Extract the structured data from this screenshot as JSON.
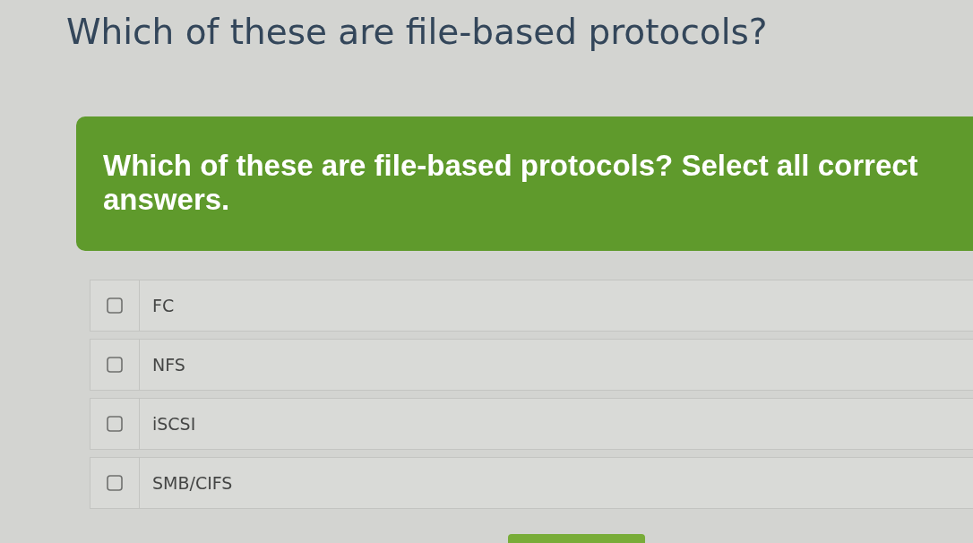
{
  "page": {
    "title": "Which of these are file-based protocols?"
  },
  "question": {
    "prompt": "Which of these are file-based protocols? Select all correct answers."
  },
  "options": [
    {
      "label": "FC",
      "checked": false
    },
    {
      "label": "NFS",
      "checked": false
    },
    {
      "label": "iSCSI",
      "checked": false
    },
    {
      "label": "SMB/CIFS",
      "checked": false
    }
  ]
}
